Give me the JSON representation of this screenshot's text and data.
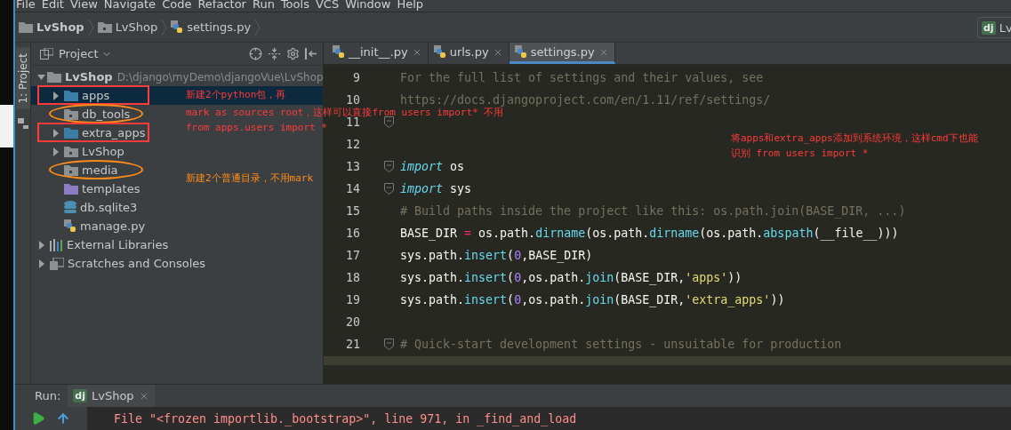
{
  "menu": [
    "File",
    "Edit",
    "View",
    "Navigate",
    "Code",
    "Refactor",
    "Run",
    "Tools",
    "VCS",
    "Window",
    "Help"
  ],
  "breadcrumbs": [
    {
      "label": "LvShop",
      "kind": "folder"
    },
    {
      "label": "LvShop",
      "kind": "package"
    },
    {
      "label": "settings.py",
      "kind": "python"
    }
  ],
  "run_config": {
    "logo": "dj",
    "label": "Lv"
  },
  "tool_strip": {
    "tab": "1: Project"
  },
  "project_panel": {
    "title": "Project"
  },
  "tree": [
    {
      "name": "LvShop",
      "path": "D:\\django\\myDemo\\djangoVue\\LvShop",
      "kind": "folder",
      "expanded": true,
      "selected": false,
      "children": [
        {
          "name": "apps",
          "kind": "source",
          "expanded": false,
          "selected": true,
          "annotation": {
            "kind": "rect",
            "color": "#ff3b3b"
          }
        },
        {
          "name": "db_tools",
          "kind": "package",
          "selected": false,
          "annotation": {
            "kind": "ellipse",
            "color": "#ff8c1a"
          }
        },
        {
          "name": "extra_apps",
          "kind": "source",
          "expanded": false,
          "selected": false,
          "annotation": {
            "kind": "rect",
            "color": "#ff3b3b"
          }
        },
        {
          "name": "LvShop",
          "kind": "package",
          "expanded": false,
          "selected": false
        },
        {
          "name": "media",
          "kind": "package",
          "selected": false,
          "annotation": {
            "kind": "ellipse",
            "color": "#ff8c1a"
          }
        },
        {
          "name": "templates",
          "kind": "templates",
          "selected": false
        },
        {
          "name": "db.sqlite3",
          "kind": "database",
          "selected": false
        },
        {
          "name": "manage.py",
          "kind": "python",
          "selected": false
        }
      ]
    },
    {
      "name": "External Libraries",
      "kind": "libraries",
      "expanded": false,
      "selected": false
    },
    {
      "name": "Scratches and Consoles",
      "kind": "scratches",
      "expanded": false,
      "selected": false
    }
  ],
  "tabs": [
    {
      "label": "__init__.py",
      "selected": false
    },
    {
      "label": "urls.py",
      "selected": false
    },
    {
      "label": "settings.py",
      "selected": true
    }
  ],
  "code": [
    {
      "number": "9",
      "fold": false,
      "tokens": [
        {
          "kind": "doc",
          "text": "For the full list of settings and their values, see"
        }
      ]
    },
    {
      "number": "10",
      "fold": false,
      "tokens": [
        {
          "kind": "doc",
          "text": "https://docs.djangoproject.com/en/1.11/ref/settings/"
        }
      ]
    },
    {
      "number": "11",
      "fold": true
    },
    {
      "number": "12",
      "fold": false
    },
    {
      "number": "13",
      "fold": true,
      "tokens": [
        {
          "kind": "keyword",
          "text": "import"
        },
        {
          "kind": "text",
          "text": " os"
        }
      ]
    },
    {
      "number": "14",
      "fold": true,
      "tokens": [
        {
          "kind": "keyword",
          "text": "import"
        },
        {
          "kind": "text",
          "text": " sys"
        }
      ]
    },
    {
      "number": "15",
      "fold": false,
      "tokens": [
        {
          "kind": "comment",
          "text": "# Build paths inside the project like this: os.path.join(BASE_DIR, ...)"
        }
      ]
    },
    {
      "number": "16",
      "fold": false,
      "tokens": [
        {
          "kind": "text",
          "text": "BASE_DIR "
        },
        {
          "kind": "op",
          "text": "="
        },
        {
          "kind": "text",
          "text": " os.path."
        },
        {
          "kind": "call",
          "text": "dirname"
        },
        {
          "kind": "text",
          "text": "(os.path."
        },
        {
          "kind": "call",
          "text": "dirname"
        },
        {
          "kind": "text",
          "text": "(os.path."
        },
        {
          "kind": "call",
          "text": "abspath"
        },
        {
          "kind": "text",
          "text": "(__file__)))"
        }
      ]
    },
    {
      "number": "17",
      "fold": false,
      "tokens": [
        {
          "kind": "text",
          "text": "sys.path."
        },
        {
          "kind": "call",
          "text": "insert"
        },
        {
          "kind": "text",
          "text": "("
        },
        {
          "kind": "number",
          "text": "0"
        },
        {
          "kind": "text",
          "text": ",BASE_DIR)"
        }
      ]
    },
    {
      "number": "18",
      "fold": false,
      "tokens": [
        {
          "kind": "text",
          "text": "sys.path."
        },
        {
          "kind": "call",
          "text": "insert"
        },
        {
          "kind": "text",
          "text": "("
        },
        {
          "kind": "number",
          "text": "0"
        },
        {
          "kind": "text",
          "text": ",os.path."
        },
        {
          "kind": "call",
          "text": "join"
        },
        {
          "kind": "text",
          "text": "(BASE_DIR,"
        },
        {
          "kind": "string",
          "text": "'apps'"
        },
        {
          "kind": "text",
          "text": "))"
        }
      ]
    },
    {
      "number": "19",
      "fold": false,
      "tokens": [
        {
          "kind": "text",
          "text": "sys.path."
        },
        {
          "kind": "call",
          "text": "insert"
        },
        {
          "kind": "text",
          "text": "("
        },
        {
          "kind": "number",
          "text": "0"
        },
        {
          "kind": "text",
          "text": ",os.path."
        },
        {
          "kind": "call",
          "text": "join"
        },
        {
          "kind": "text",
          "text": "(BASE_DIR,"
        },
        {
          "kind": "string",
          "text": "'extra_apps'"
        },
        {
          "kind": "text",
          "text": "))"
        }
      ]
    },
    {
      "number": "20",
      "fold": false
    },
    {
      "number": "21",
      "fold": true,
      "tokens": [
        {
          "kind": "comment",
          "text": "# Quick-start development settings - unsuitable for production"
        }
      ]
    }
  ],
  "annotations": [
    {
      "text": "新建2个python包，再",
      "color": "#ff3b3b"
    },
    {
      "text": "mark as sources root，这样可以直接from users import* 不用",
      "color": "#ff3b3b"
    },
    {
      "text": "from apps.users import *",
      "color": "#ff3b3b"
    },
    {
      "text": "新建2个普通目录，不用mark",
      "color": "#ff8c1a"
    },
    {
      "text": "将apps和extra_apps添加到系统环境，这样cmd下也能",
      "color": "#ff3b3b"
    },
    {
      "text": "识别 from users import *",
      "color": "#ff3b3b"
    }
  ],
  "run_panel": {
    "label": "Run:",
    "tab": {
      "logo": "dj",
      "label": "LvShop"
    },
    "output": "File \"<frozen importlib._bootstrap>\", line 971, in _find_and_load"
  }
}
